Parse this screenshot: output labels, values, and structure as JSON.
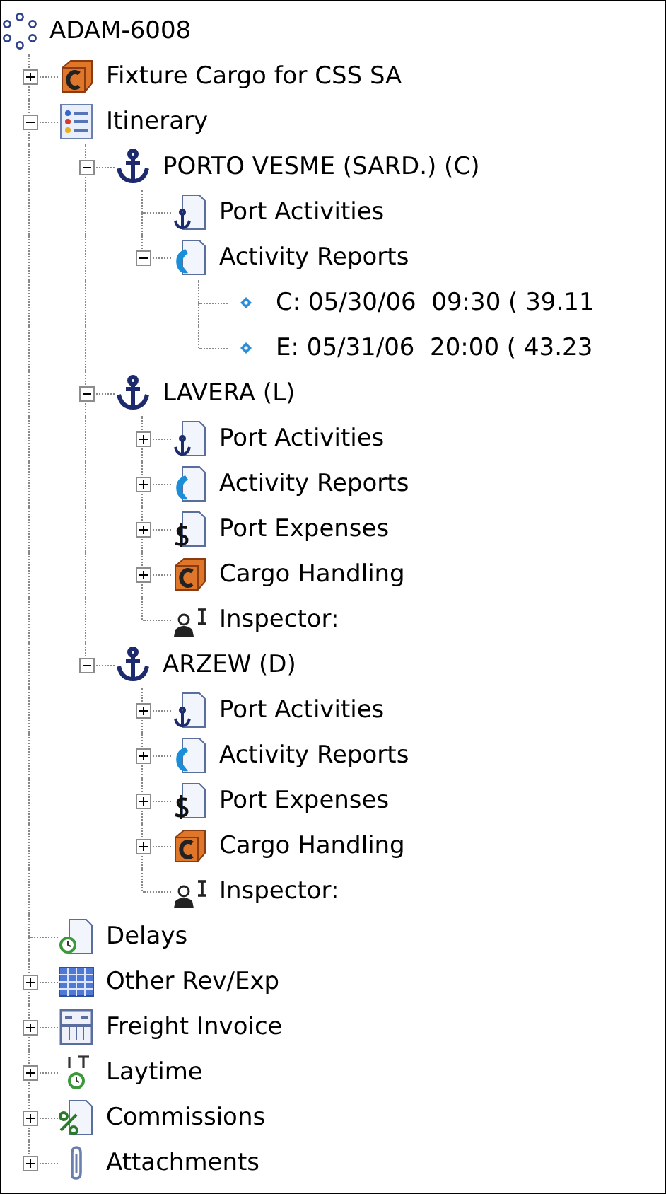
{
  "tree": {
    "label": "ADAM-6008",
    "kind": "root",
    "children": [
      {
        "label": "Fixture Cargo for CSS SA",
        "kind": "cargo",
        "expanded": false
      },
      {
        "label": "Itinerary",
        "kind": "itinerary",
        "expanded": true,
        "children": [
          {
            "label": "PORTO VESME (SARD.) (C)",
            "kind": "port",
            "expanded": true,
            "children": [
              {
                "label": "Port Activities",
                "kind": "activities"
              },
              {
                "label": "Activity Reports",
                "kind": "reports",
                "expanded": true,
                "children": [
                  {
                    "label": "C: 05/30/06  09:30 ( 39.11",
                    "kind": "entry"
                  },
                  {
                    "label": "E: 05/31/06  20:00 ( 43.23",
                    "kind": "entry"
                  }
                ]
              }
            ]
          },
          {
            "label": "LAVERA (L)",
            "kind": "port",
            "expanded": true,
            "children": [
              {
                "label": "Port Activities",
                "kind": "activities",
                "expanded": false
              },
              {
                "label": "Activity Reports",
                "kind": "reports",
                "expanded": false
              },
              {
                "label": "Port Expenses",
                "kind": "expenses",
                "expanded": false
              },
              {
                "label": "Cargo Handling",
                "kind": "cargo",
                "expanded": false
              },
              {
                "label": "Inspector:",
                "kind": "inspector"
              }
            ]
          },
          {
            "label": "ARZEW (D)",
            "kind": "port",
            "expanded": true,
            "children": [
              {
                "label": "Port Activities",
                "kind": "activities",
                "expanded": false
              },
              {
                "label": "Activity Reports",
                "kind": "reports",
                "expanded": false
              },
              {
                "label": "Port Expenses",
                "kind": "expenses",
                "expanded": false
              },
              {
                "label": "Cargo Handling",
                "kind": "cargo",
                "expanded": false
              },
              {
                "label": "Inspector:",
                "kind": "inspector"
              }
            ]
          }
        ]
      },
      {
        "label": "Delays",
        "kind": "delays"
      },
      {
        "label": "Other Rev/Exp",
        "kind": "grid",
        "expanded": false
      },
      {
        "label": "Freight Invoice",
        "kind": "invoice",
        "expanded": false
      },
      {
        "label": "Laytime",
        "kind": "laytime",
        "expanded": false
      },
      {
        "label": "Commissions",
        "kind": "commissions",
        "expanded": false
      },
      {
        "label": "Attachments",
        "kind": "attachments",
        "expanded": false
      }
    ]
  }
}
